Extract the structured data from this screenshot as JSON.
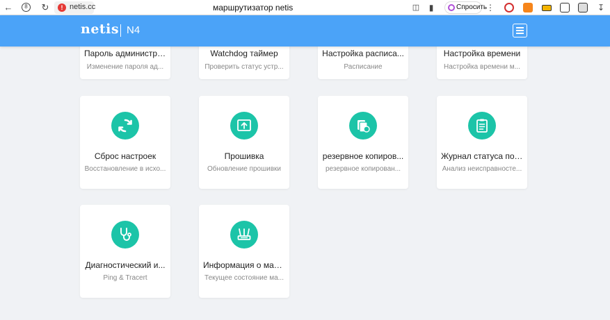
{
  "browser": {
    "url": "netis.cc",
    "tab_title": "маршрутизатор netis",
    "ask_label": "Спросить"
  },
  "header": {
    "brand": "netis",
    "model": "N4"
  },
  "cards": [
    {
      "title": "Пароль администра...",
      "subtitle": "Изменение пароля ад..."
    },
    {
      "title": "Watchdog таймер",
      "subtitle": "Проверить статус устр..."
    },
    {
      "title": "Настройка расписа...",
      "subtitle": "Расписание"
    },
    {
      "title": "Настройка времени",
      "subtitle": "Настройка времени м..."
    },
    {
      "title": "Сброс настроек",
      "subtitle": "Восстановление в исхо...",
      "icon": "sync-icon"
    },
    {
      "title": "Прошивка",
      "subtitle": "Обновление прошивки",
      "icon": "upload-icon"
    },
    {
      "title": "резервное копиров...",
      "subtitle": "резервное копирован...",
      "icon": "backup-icon"
    },
    {
      "title": "Журнал статуса под...",
      "subtitle": "Анализ неисправносте...",
      "icon": "clipboard-icon"
    },
    {
      "title": "Диагностический и...",
      "subtitle": "Ping & Tracert",
      "icon": "stethoscope-icon"
    },
    {
      "title": "Информация о мар...",
      "subtitle": "Текущее состояние ма...",
      "icon": "router-icon"
    }
  ],
  "colors": {
    "header": "#4ba3f8",
    "icon_bg": "#1cc4a8",
    "page_bg": "#f0f2f5"
  }
}
